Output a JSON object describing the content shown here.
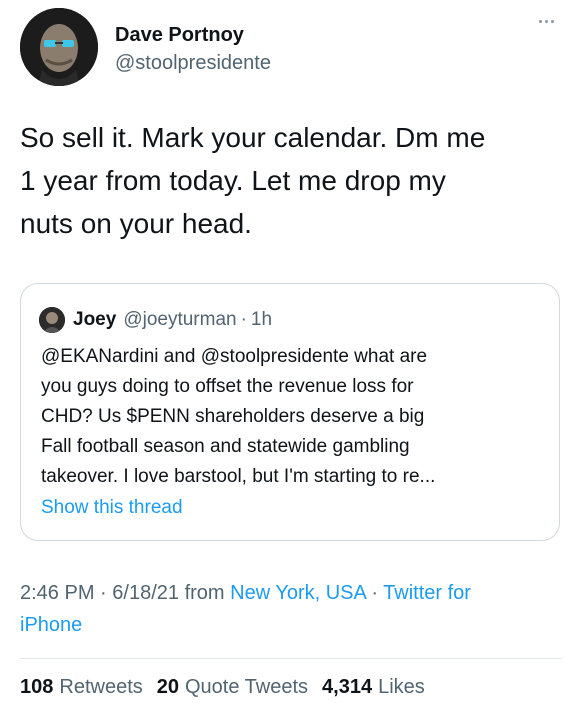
{
  "tweet": {
    "author": {
      "name": "Dave Portnoy",
      "handle": "@stoolpresidente"
    },
    "text": "So sell it.  Mark your calendar.  Dm me\n1 year from today.  Let me drop my\nnuts on your head.",
    "quote": {
      "name": "Joey",
      "handle": "@joeyturman",
      "time": "1h",
      "text_lines": [
        "@EKANardini and @stoolpresidente what are",
        "you guys doing to offset the revenue loss for",
        "CHD? Us $PENN shareholders deserve a big",
        "Fall football season and statewide gambling",
        "takeover. I love barstool, but I'm starting to re..."
      ],
      "show_thread": "Show this thread"
    },
    "meta": {
      "time": "2:46 PM",
      "date": "6/18/21",
      "from_label": "from",
      "location": "New York, USA",
      "client_prefix": "Twitter for",
      "client_suffix": "iPhone"
    },
    "stats": {
      "retweets_count": "108",
      "retweets_label": "Retweets",
      "quotes_count": "20",
      "quotes_label": "Quote Tweets",
      "likes_count": "4,314",
      "likes_label": "Likes"
    }
  },
  "colors": {
    "text": "#0f1419",
    "secondary": "#536471",
    "link": "#1d9bf0",
    "border": "#cfd9de"
  },
  "icons": {
    "more": "more-horizontal-icon"
  }
}
